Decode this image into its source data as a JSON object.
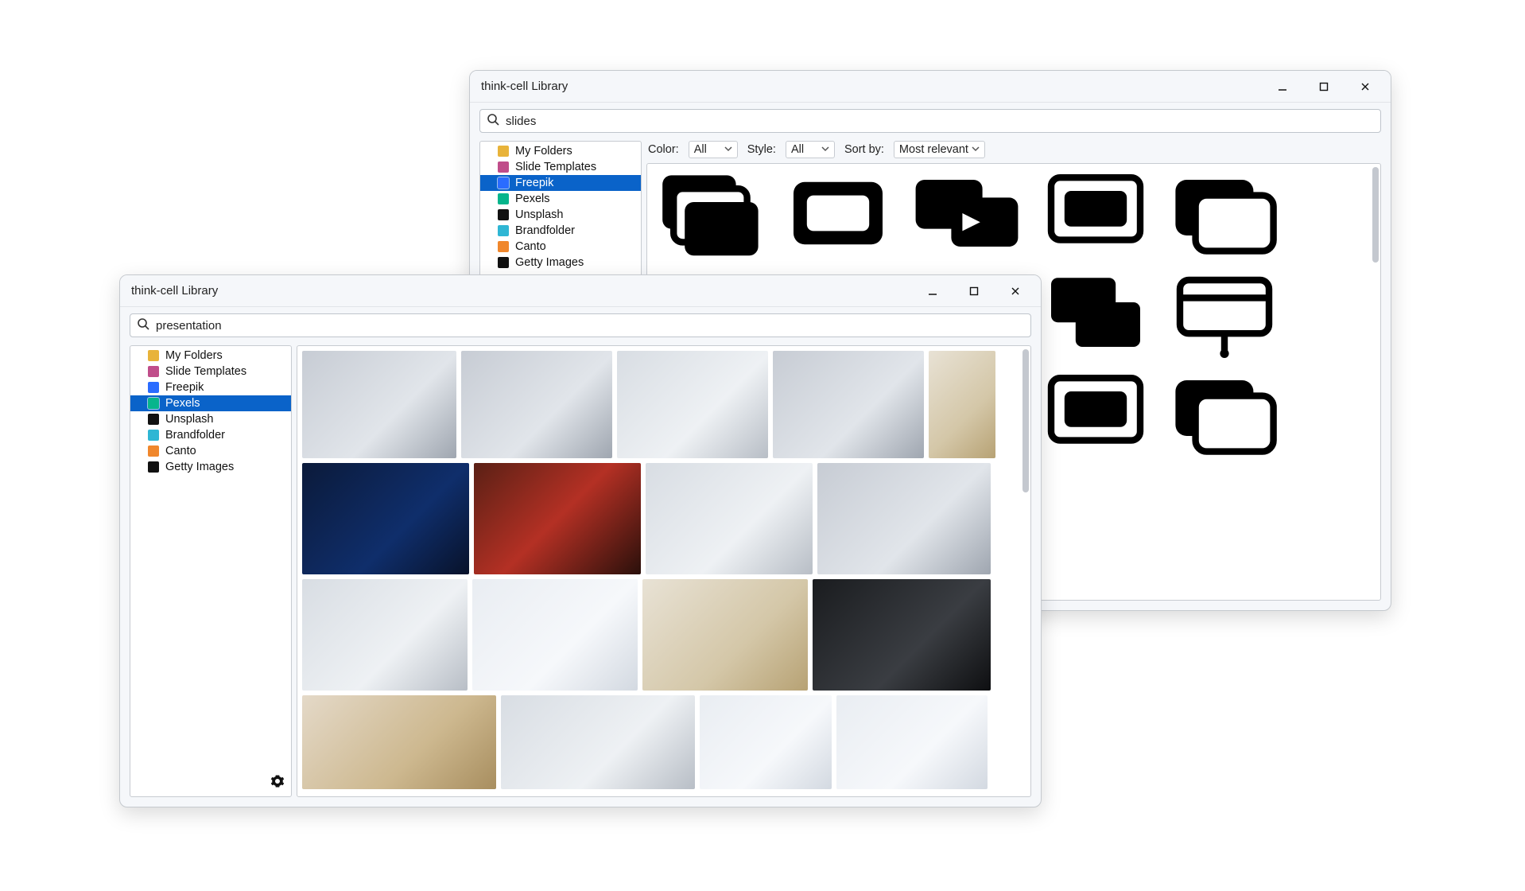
{
  "window_back": {
    "title": "think-cell Library",
    "search_value": "slides",
    "filters": {
      "color_label": "Color:",
      "color_value": "All",
      "style_label": "Style:",
      "style_value": "All",
      "sort_label": "Sort by:",
      "sort_value": "Most relevant"
    },
    "sidebar": {
      "items": [
        {
          "label": "My Folders",
          "icon": "folder-icon",
          "color": "#e8b33a",
          "selected": false
        },
        {
          "label": "Slide Templates",
          "icon": "template-icon",
          "color": "#c04d8a",
          "selected": false
        },
        {
          "label": "Freepik",
          "icon": "freepik-icon",
          "color": "#2a6cff",
          "selected": true
        },
        {
          "label": "Pexels",
          "icon": "pexels-icon",
          "color": "#06b58c",
          "selected": false
        },
        {
          "label": "Unsplash",
          "icon": "unsplash-icon",
          "color": "#111111",
          "selected": false
        },
        {
          "label": "Brandfolder",
          "icon": "brandfolder-icon",
          "color": "#2fb6d4",
          "selected": false
        },
        {
          "label": "Canto",
          "icon": "canto-icon",
          "color": "#f0872c",
          "selected": false
        },
        {
          "label": "Getty Images",
          "icon": "getty-icon",
          "color": "#111111",
          "selected": false
        }
      ]
    }
  },
  "window_front": {
    "title": "think-cell Library",
    "search_value": "presentation",
    "sidebar": {
      "items": [
        {
          "label": "My Folders",
          "icon": "folder-icon",
          "color": "#e8b33a",
          "selected": false
        },
        {
          "label": "Slide Templates",
          "icon": "template-icon",
          "color": "#c04d8a",
          "selected": false
        },
        {
          "label": "Freepik",
          "icon": "freepik-icon",
          "color": "#2a6cff",
          "selected": false
        },
        {
          "label": "Pexels",
          "icon": "pexels-icon",
          "color": "#06b58c",
          "selected": true
        },
        {
          "label": "Unsplash",
          "icon": "unsplash-icon",
          "color": "#111111",
          "selected": false
        },
        {
          "label": "Brandfolder",
          "icon": "brandfolder-icon",
          "color": "#2fb6d4",
          "selected": false
        },
        {
          "label": "Canto",
          "icon": "canto-icon",
          "color": "#f0872c",
          "selected": false
        },
        {
          "label": "Getty Images",
          "icon": "getty-icon",
          "color": "#111111",
          "selected": false
        }
      ]
    }
  }
}
